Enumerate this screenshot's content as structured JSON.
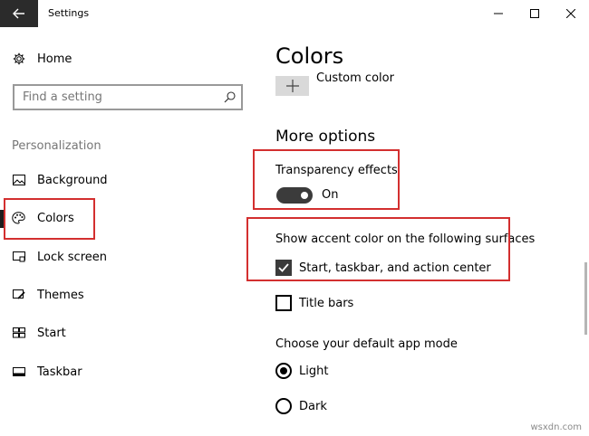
{
  "window": {
    "title": "Settings"
  },
  "sidebar": {
    "home_label": "Home",
    "search_placeholder": "Find a setting",
    "section_heading": "Personalization",
    "items": [
      {
        "label": "Background",
        "icon": "picture-icon"
      },
      {
        "label": "Colors",
        "icon": "palette-icon",
        "active": true
      },
      {
        "label": "Lock screen",
        "icon": "lock-screen-icon"
      },
      {
        "label": "Themes",
        "icon": "brush-icon"
      },
      {
        "label": "Start",
        "icon": "start-tiles-icon"
      },
      {
        "label": "Taskbar",
        "icon": "taskbar-icon"
      }
    ]
  },
  "content": {
    "title": "Colors",
    "custom_color_label": "Custom color",
    "more_options_heading": "More options",
    "transparency": {
      "label": "Transparency effects",
      "state_label": "On",
      "on": true
    },
    "accent_surfaces": {
      "label": "Show accent color on the following surfaces",
      "options": [
        {
          "label": "Start, taskbar, and action center",
          "checked": true
        },
        {
          "label": "Title bars",
          "checked": false
        }
      ]
    },
    "app_mode": {
      "label": "Choose your default app mode",
      "options": [
        {
          "label": "Light",
          "selected": true
        },
        {
          "label": "Dark",
          "selected": false
        }
      ]
    }
  },
  "watermark": "wsxdn.com",
  "colors": {
    "annotation_red": "#d32f2f",
    "toggle_on": "#3b3b3b",
    "back_button_bg": "#2b2b2b"
  }
}
